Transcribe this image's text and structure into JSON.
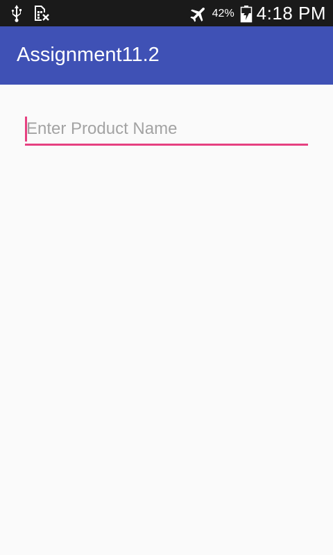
{
  "status_bar": {
    "left_icons": [
      "usb-icon",
      "no-sim-icon"
    ],
    "right_icons": [
      "airplane-icon",
      "battery-charging-icon"
    ],
    "battery_percent": "42%",
    "time": "4:18 PM"
  },
  "app_bar": {
    "title": "Assignment11.2",
    "color": "#3f51b5"
  },
  "form": {
    "product_name": {
      "placeholder": "Enter Product Name",
      "value": "",
      "accent_color": "#e64080"
    }
  }
}
